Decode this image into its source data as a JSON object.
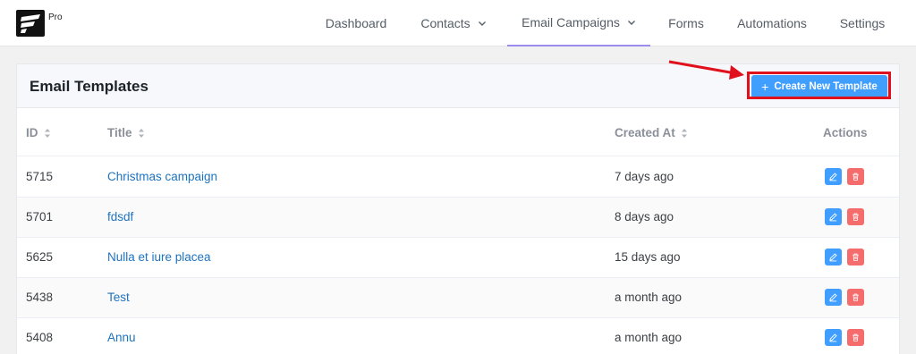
{
  "header": {
    "badge": "Pro",
    "nav": [
      {
        "label": "Dashboard"
      },
      {
        "label": "Contacts"
      },
      {
        "label": "Email Campaigns"
      },
      {
        "label": "Forms"
      },
      {
        "label": "Automations"
      },
      {
        "label": "Settings"
      }
    ]
  },
  "page": {
    "title": "Email Templates",
    "create_button": "Create New Template"
  },
  "table": {
    "columns": [
      "ID",
      "Title",
      "Created At",
      "Actions"
    ],
    "rows": [
      {
        "id": "5715",
        "title": "Christmas campaign",
        "created": "7 days ago"
      },
      {
        "id": "5701",
        "title": "fdsdf",
        "created": "8 days ago"
      },
      {
        "id": "5625",
        "title": "Nulla et iure placea",
        "created": "15 days ago"
      },
      {
        "id": "5438",
        "title": "Test",
        "created": "a month ago"
      },
      {
        "id": "5408",
        "title": "Annu",
        "created": "a month ago"
      }
    ]
  },
  "colors": {
    "primary": "#409eff",
    "danger": "#f56c6c",
    "annotation": "#e0101c",
    "active_tab_underline": "#9b8cf0"
  }
}
